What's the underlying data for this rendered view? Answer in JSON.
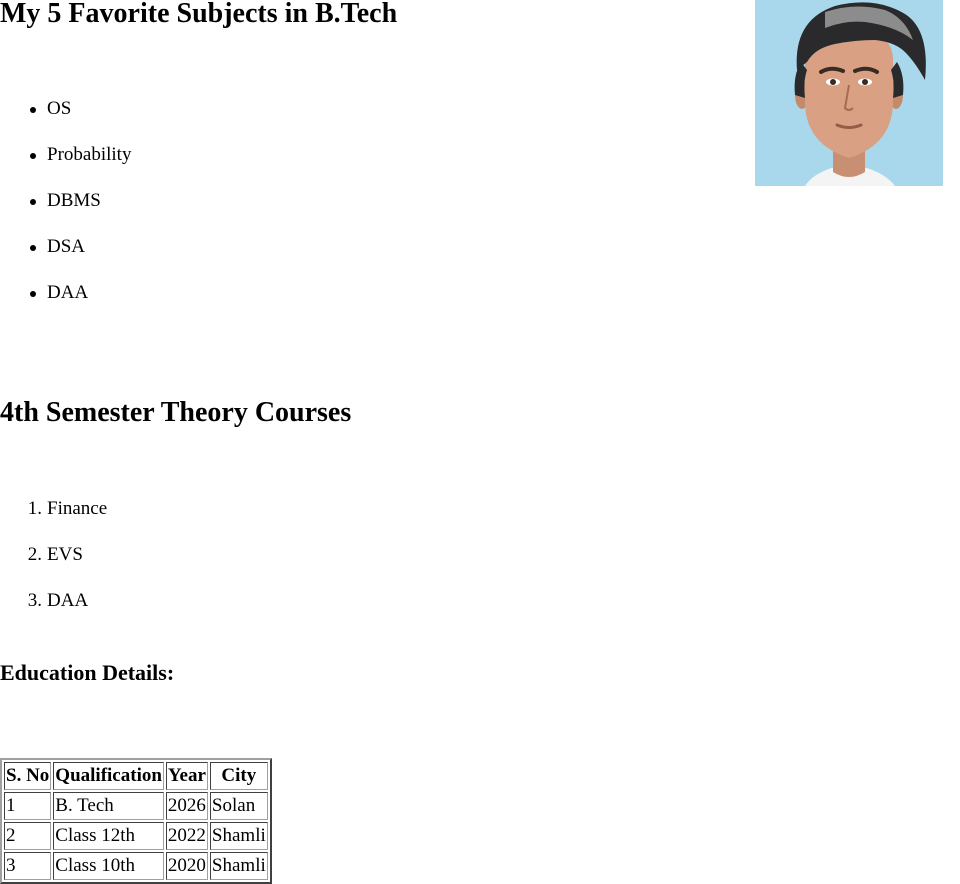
{
  "favorites": {
    "title": "My 5 Favorite Subjects in B.Tech",
    "items": [
      "OS",
      "Probability",
      "DBMS",
      "DSA",
      "DAA"
    ]
  },
  "courses": {
    "title": "4th Semester Theory Courses",
    "items": [
      "Finance",
      "EVS",
      "DAA"
    ]
  },
  "education": {
    "title": "Education Details:",
    "headers": [
      "S. No",
      "Qualification",
      "Year",
      "City"
    ],
    "rows": [
      [
        "1",
        "B. Tech",
        "2026",
        "Solan"
      ],
      [
        "2",
        "Class 12th",
        "2022",
        "Shamli"
      ],
      [
        "3",
        "Class 10th",
        "2020",
        "Shamli"
      ]
    ]
  },
  "colors": {
    "photo_background": "#a9d8ec"
  }
}
